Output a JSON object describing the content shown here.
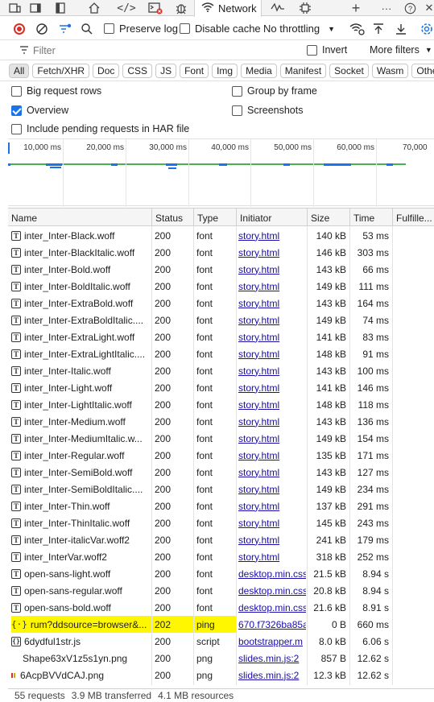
{
  "devtools": {
    "active_tab": "Network",
    "tab_icons": [
      "device-toolbar-icon",
      "elements-icon",
      "sources-icon",
      "console-icon",
      "bug-icon",
      "performance-icon",
      "settings-icon"
    ]
  },
  "toolbar": {
    "preserve_log": "Preserve log",
    "disable_cache": "Disable cache",
    "throttling": "No throttling"
  },
  "filter": {
    "placeholder": "Filter",
    "invert": "Invert",
    "more_filters": "More filters"
  },
  "types": [
    "All",
    "Fetch/XHR",
    "Doc",
    "CSS",
    "JS",
    "Font",
    "Img",
    "Media",
    "Manifest",
    "Socket",
    "Wasm",
    "Other"
  ],
  "options": {
    "big_rows": "Big request rows",
    "group_by_frame": "Group by frame",
    "overview": "Overview",
    "screenshots": "Screenshots",
    "include_pending": "Include pending requests in HAR file"
  },
  "overview_ticks": [
    "10,000 ms",
    "20,000 ms",
    "30,000 ms",
    "40,000 ms",
    "50,000 ms",
    "60,000 ms",
    "70,000"
  ],
  "table": {
    "headers": [
      "Name",
      "Status",
      "Type",
      "Initiator",
      "Size",
      "Time",
      "Fulfille..."
    ],
    "rows": [
      {
        "name": "inter_Inter-Black.woff",
        "status": "200",
        "type": "font",
        "initiator": "story.html",
        "size": "140 kB",
        "time": "53 ms",
        "icon": "font"
      },
      {
        "name": "inter_Inter-BlackItalic.woff",
        "status": "200",
        "type": "font",
        "initiator": "story.html",
        "size": "146 kB",
        "time": "303 ms",
        "icon": "font"
      },
      {
        "name": "inter_Inter-Bold.woff",
        "status": "200",
        "type": "font",
        "initiator": "story.html",
        "size": "143 kB",
        "time": "66 ms",
        "icon": "font"
      },
      {
        "name": "inter_Inter-BoldItalic.woff",
        "status": "200",
        "type": "font",
        "initiator": "story.html",
        "size": "149 kB",
        "time": "111 ms",
        "icon": "font"
      },
      {
        "name": "inter_Inter-ExtraBold.woff",
        "status": "200",
        "type": "font",
        "initiator": "story.html",
        "size": "143 kB",
        "time": "164 ms",
        "icon": "font"
      },
      {
        "name": "inter_Inter-ExtraBoldItalic....",
        "status": "200",
        "type": "font",
        "initiator": "story.html",
        "size": "149 kB",
        "time": "74 ms",
        "icon": "font"
      },
      {
        "name": "inter_Inter-ExtraLight.woff",
        "status": "200",
        "type": "font",
        "initiator": "story.html",
        "size": "141 kB",
        "time": "83 ms",
        "icon": "font"
      },
      {
        "name": "inter_Inter-ExtraLightItalic....",
        "status": "200",
        "type": "font",
        "initiator": "story.html",
        "size": "148 kB",
        "time": "91 ms",
        "icon": "font"
      },
      {
        "name": "inter_Inter-Italic.woff",
        "status": "200",
        "type": "font",
        "initiator": "story.html",
        "size": "143 kB",
        "time": "100 ms",
        "icon": "font"
      },
      {
        "name": "inter_Inter-Light.woff",
        "status": "200",
        "type": "font",
        "initiator": "story.html",
        "size": "141 kB",
        "time": "146 ms",
        "icon": "font"
      },
      {
        "name": "inter_Inter-LightItalic.woff",
        "status": "200",
        "type": "font",
        "initiator": "story.html",
        "size": "148 kB",
        "time": "118 ms",
        "icon": "font"
      },
      {
        "name": "inter_Inter-Medium.woff",
        "status": "200",
        "type": "font",
        "initiator": "story.html",
        "size": "143 kB",
        "time": "136 ms",
        "icon": "font"
      },
      {
        "name": "inter_Inter-MediumItalic.w...",
        "status": "200",
        "type": "font",
        "initiator": "story.html",
        "size": "149 kB",
        "time": "154 ms",
        "icon": "font"
      },
      {
        "name": "inter_Inter-Regular.woff",
        "status": "200",
        "type": "font",
        "initiator": "story.html",
        "size": "135 kB",
        "time": "171 ms",
        "icon": "font"
      },
      {
        "name": "inter_Inter-SemiBold.woff",
        "status": "200",
        "type": "font",
        "initiator": "story.html",
        "size": "143 kB",
        "time": "127 ms",
        "icon": "font"
      },
      {
        "name": "inter_Inter-SemiBoldItalic....",
        "status": "200",
        "type": "font",
        "initiator": "story.html",
        "size": "149 kB",
        "time": "234 ms",
        "icon": "font"
      },
      {
        "name": "inter_Inter-Thin.woff",
        "status": "200",
        "type": "font",
        "initiator": "story.html",
        "size": "137 kB",
        "time": "291 ms",
        "icon": "font"
      },
      {
        "name": "inter_Inter-ThinItalic.woff",
        "status": "200",
        "type": "font",
        "initiator": "story.html",
        "size": "145 kB",
        "time": "243 ms",
        "icon": "font"
      },
      {
        "name": "inter_Inter-italicVar.woff2",
        "status": "200",
        "type": "font",
        "initiator": "story.html",
        "size": "241 kB",
        "time": "179 ms",
        "icon": "font"
      },
      {
        "name": "inter_InterVar.woff2",
        "status": "200",
        "type": "font",
        "initiator": "story.html",
        "size": "318 kB",
        "time": "252 ms",
        "icon": "font"
      },
      {
        "name": "open-sans-light.woff",
        "status": "200",
        "type": "font",
        "initiator": "desktop.min.css",
        "size": "21.5 kB",
        "time": "8.94 s",
        "icon": "font"
      },
      {
        "name": "open-sans-regular.woff",
        "status": "200",
        "type": "font",
        "initiator": "desktop.min.css",
        "size": "20.8 kB",
        "time": "8.94 s",
        "icon": "font"
      },
      {
        "name": "open-sans-bold.woff",
        "status": "200",
        "type": "font",
        "initiator": "desktop.min.css",
        "size": "21.6 kB",
        "time": "8.91 s",
        "icon": "font"
      },
      {
        "name": "rum?ddsource=browser&...",
        "status": "202",
        "type": "ping",
        "initiator": "670.f7326ba85a",
        "size": "0 B",
        "time": "660 ms",
        "icon": "ping",
        "highlighted": true
      },
      {
        "name": "6dydful1str.js",
        "status": "200",
        "type": "script",
        "initiator": "bootstrapper.m",
        "size": "8.0 kB",
        "time": "6.06 s",
        "icon": "script"
      },
      {
        "name": "Shape63xV1z5s1yn.png",
        "status": "200",
        "type": "png",
        "initiator": "slides.min.js:2",
        "size": "857 B",
        "time": "12.62 s",
        "icon": "none"
      },
      {
        "name": "6AcpBVVdCAJ.png",
        "status": "200",
        "type": "png",
        "initiator": "slides.min.js:2",
        "size": "12.3 kB",
        "time": "12.62 s",
        "icon": "image"
      }
    ]
  },
  "status": {
    "requests": "55 requests",
    "transferred": "3.9 MB transferred",
    "resources": "4.1 MB resources"
  }
}
